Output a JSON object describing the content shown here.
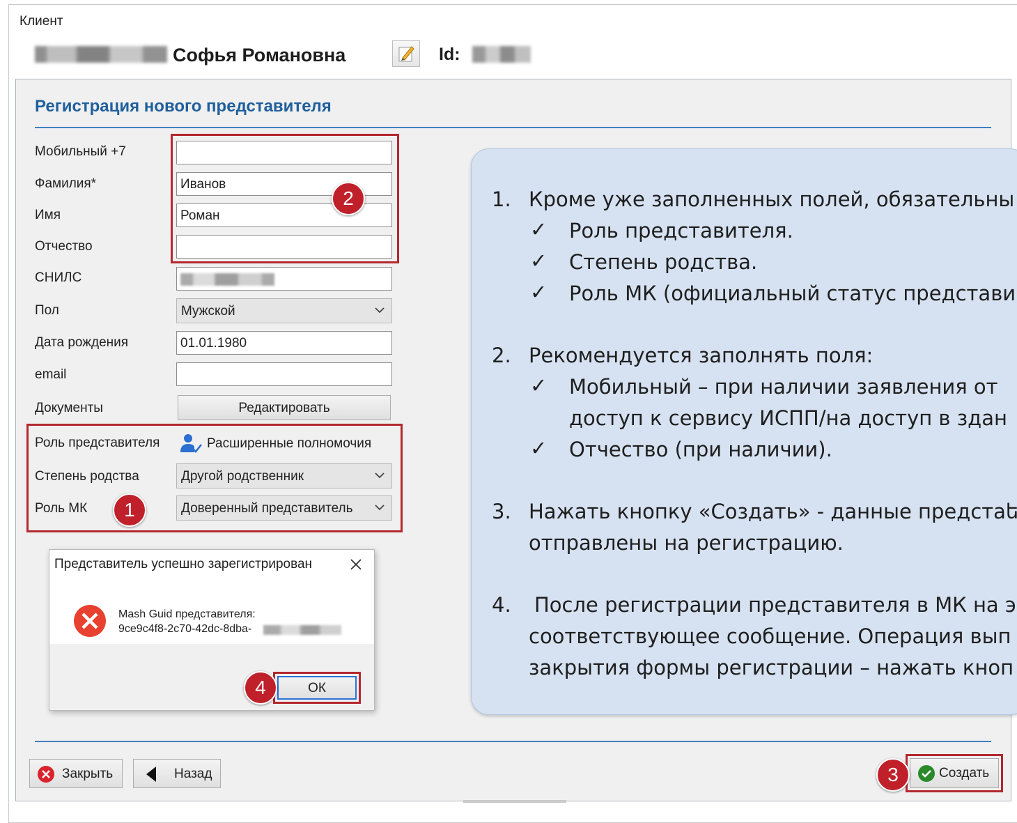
{
  "group_caption": "Клиент",
  "client": {
    "name": "Софья Романовна",
    "id_label": "Id:"
  },
  "panel_title": "Регистрация нового представителя",
  "form": {
    "mobile": {
      "label": "Мобильный  +7",
      "value": ""
    },
    "surname": {
      "label": "Фамилия*",
      "value": "Иванов"
    },
    "name": {
      "label": "Имя",
      "value": "Роман"
    },
    "patronymic": {
      "label": "Отчество",
      "value": ""
    },
    "snils": {
      "label": "СНИЛС"
    },
    "gender": {
      "label": "Пол",
      "value": "Мужской"
    },
    "birthdate": {
      "label": "Дата рождения",
      "value": "01.01.1980"
    },
    "email": {
      "label": "email",
      "value": ""
    },
    "documents": {
      "label": "Документы",
      "button": "Редактировать"
    },
    "role": {
      "label": "Роль представителя",
      "value": "Расширенные полномочия"
    },
    "kinship": {
      "label": "Степень родства",
      "value": "Другой родственник"
    },
    "mk_role": {
      "label": "Роль МК",
      "value": "Доверенный представитель"
    }
  },
  "dialog": {
    "title": "Представитель успешно зарегистрирован",
    "message_line1": "Mash Guid представителя:",
    "message_line2": "9ce9c4f8-2c70-42dc-8dba-",
    "ok": "ОК"
  },
  "buttons": {
    "close": "Закрыть",
    "back": "Назад",
    "create": "Создать"
  },
  "badges": [
    "1",
    "2",
    "3",
    "4"
  ],
  "instructions": {
    "item1": {
      "num": "1.",
      "text": "Кроме уже заполненных полей, обязательны",
      "checks": [
        "Роль представителя.",
        "Степень родства.",
        "Роль МК (официальный статус представи"
      ]
    },
    "item2": {
      "num": "2.",
      "text": "Рекомендуется заполнять поля:",
      "checks": [
        "Мобильный – при наличии заявления от",
        "доступ к сервису ИСПП/на доступ в здан",
        "Отчество (при наличии)."
      ]
    },
    "item3": {
      "num": "3.",
      "line1": "Нажать кнопку «Создать» - данные предстаե",
      "line2": "отправлены на регистрацию."
    },
    "item4": {
      "num": "4.",
      "line1": "После регистрации представителя в МК на э",
      "line2": "соответствующее сообщение. Операция вып",
      "line3": "закрытия формы регистрации – нажать кноп"
    },
    "check_mark": "✓"
  },
  "colors": {
    "accent": "#1f5f9c",
    "highlight": "#b4282e",
    "callout_bg": "#d6e2f1"
  }
}
